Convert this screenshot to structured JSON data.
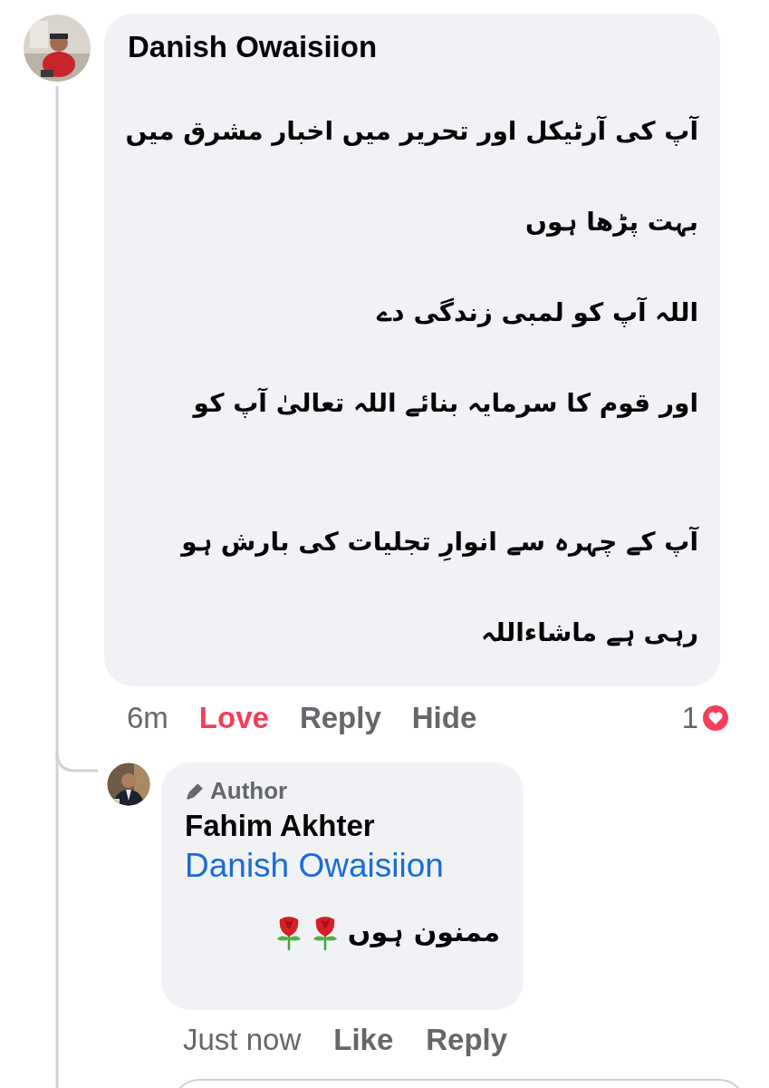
{
  "comment": {
    "author": "Danish Owaisiion",
    "paragraphs": [
      [
        "آپ کی آرٹیکل اور تحریر میں اخبار مشرق میں",
        "بہت پڑھا ہوں",
        "اللہ آپ کو لمبی زندگی دے",
        "اور قوم کا سرمایہ بنائے اللہ تعالیٰ آپ کو"
      ],
      [
        "آپ کے چہرہ سے انوارِ تجلیات کی بارش ہو",
        "رہی ہے ماشاءاللہ"
      ]
    ],
    "time": "6m",
    "reaction": {
      "label": "Love",
      "selected": true
    },
    "reply_link": "Reply",
    "hide_link": "Hide",
    "reaction_count": "1"
  },
  "reply": {
    "badge": "Author",
    "author": "Fahim Akhter",
    "mention": "Danish Owaisiion",
    "text": "ممنون ہوں",
    "emoji": [
      {
        "kind": "rose"
      },
      {
        "kind": "rose"
      }
    ],
    "time": "Just now",
    "reaction": {
      "label": "Like",
      "selected": false
    },
    "reply_link": "Reply"
  }
}
